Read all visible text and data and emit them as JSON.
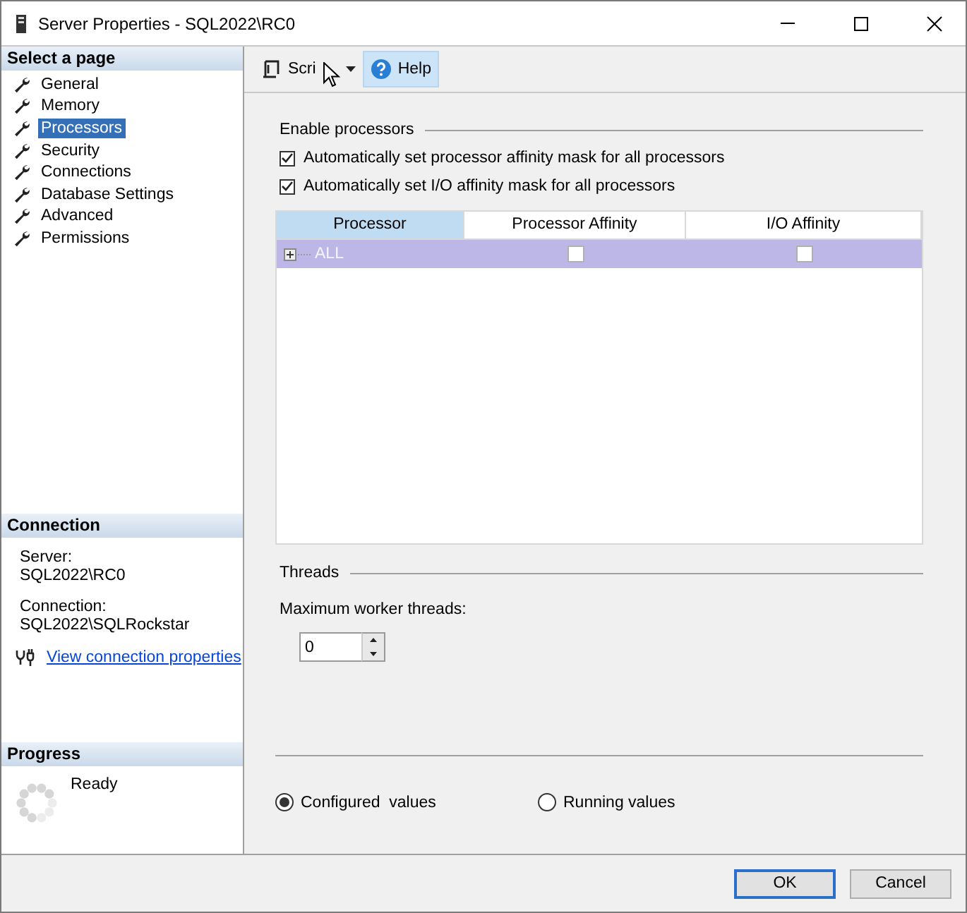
{
  "window": {
    "title": "Server Properties - SQL2022\\RC0"
  },
  "sidebar": {
    "header": "Select a page",
    "items": [
      {
        "label": "General",
        "selected": false
      },
      {
        "label": "Memory",
        "selected": false
      },
      {
        "label": "Processors",
        "selected": true
      },
      {
        "label": "Security",
        "selected": false
      },
      {
        "label": "Connections",
        "selected": false
      },
      {
        "label": "Database Settings",
        "selected": false
      },
      {
        "label": "Advanced",
        "selected": false
      },
      {
        "label": "Permissions",
        "selected": false
      }
    ]
  },
  "connection": {
    "header": "Connection",
    "server_label": "Server:",
    "server": "SQL2022\\RC0",
    "connection_label": "Connection:",
    "connection": "SQL2022\\SQLRockstar",
    "link": "View connection properties"
  },
  "progress": {
    "header": "Progress",
    "status": "Ready"
  },
  "toolbar": {
    "script": "Scri",
    "help": "Help"
  },
  "enable_processors": {
    "title": "Enable processors",
    "options": [
      {
        "label": "Automatically set processor affinity mask for all processors",
        "checked": true
      },
      {
        "label": "Automatically set I/O affinity mask for all processors",
        "checked": true
      }
    ]
  },
  "grid": {
    "columns": [
      "Processor",
      "Processor Affinity",
      "I/O Affinity"
    ],
    "rows": [
      {
        "processor": "ALL",
        "expanded": false,
        "selected": true,
        "processor_affinity": false,
        "io_affinity": false
      }
    ]
  },
  "threads": {
    "title": "Threads",
    "label": "Maximum worker threads:",
    "value": "0"
  },
  "values_mode": [
    {
      "label": "Configured  values",
      "selected": true
    },
    {
      "label": "Running values",
      "selected": false
    }
  ],
  "buttons": [
    {
      "label": "OK",
      "default": true
    },
    {
      "label": "Cancel",
      "default": false
    }
  ]
}
